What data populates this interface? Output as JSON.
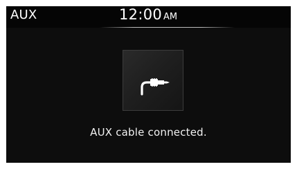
{
  "header": {
    "source": "AUX",
    "time": "12:00",
    "ampm": "AM"
  },
  "main": {
    "icon": "aux-cable-plug-icon",
    "message": "AUX cable connected."
  },
  "colors": {
    "screen_background": "#0d0d0d",
    "text": "#ffffff",
    "tile_border": "#3c3c3c"
  }
}
